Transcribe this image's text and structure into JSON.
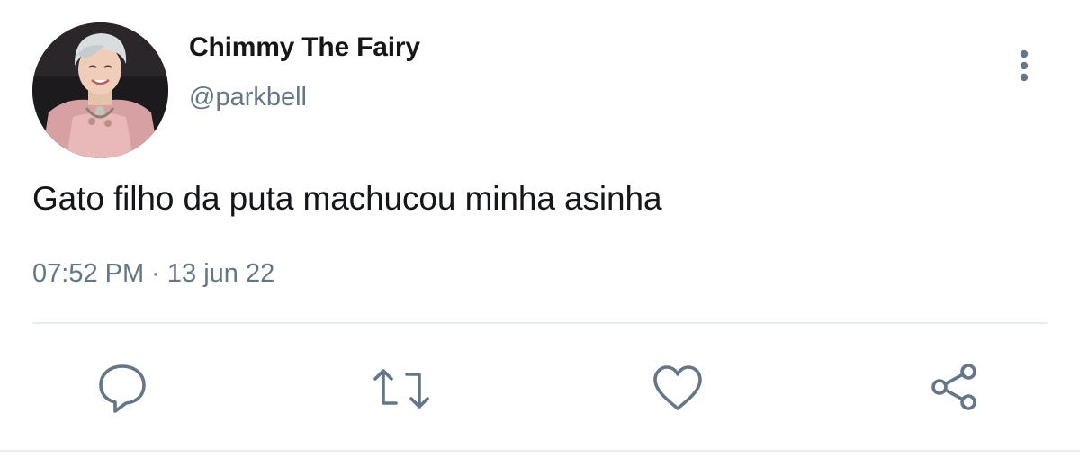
{
  "author": {
    "display_name": "Chimmy The Fairy",
    "handle": "@parkbell",
    "avatar_icon": "profile-photo"
  },
  "tweet": {
    "text": "Gato filho da puta machucou minha asinha",
    "timestamp": "07:52 PM · 13 jun 22"
  },
  "actions": {
    "reply_icon": "reply-icon",
    "retweet_icon": "retweet-icon",
    "like_icon": "heart-icon",
    "share_icon": "share-icon",
    "more_icon": "more-vertical-icon"
  },
  "colors": {
    "text_primary": "#14171a",
    "text_secondary": "#657786",
    "icon": "#657786",
    "divider": "#e6ecf0"
  }
}
